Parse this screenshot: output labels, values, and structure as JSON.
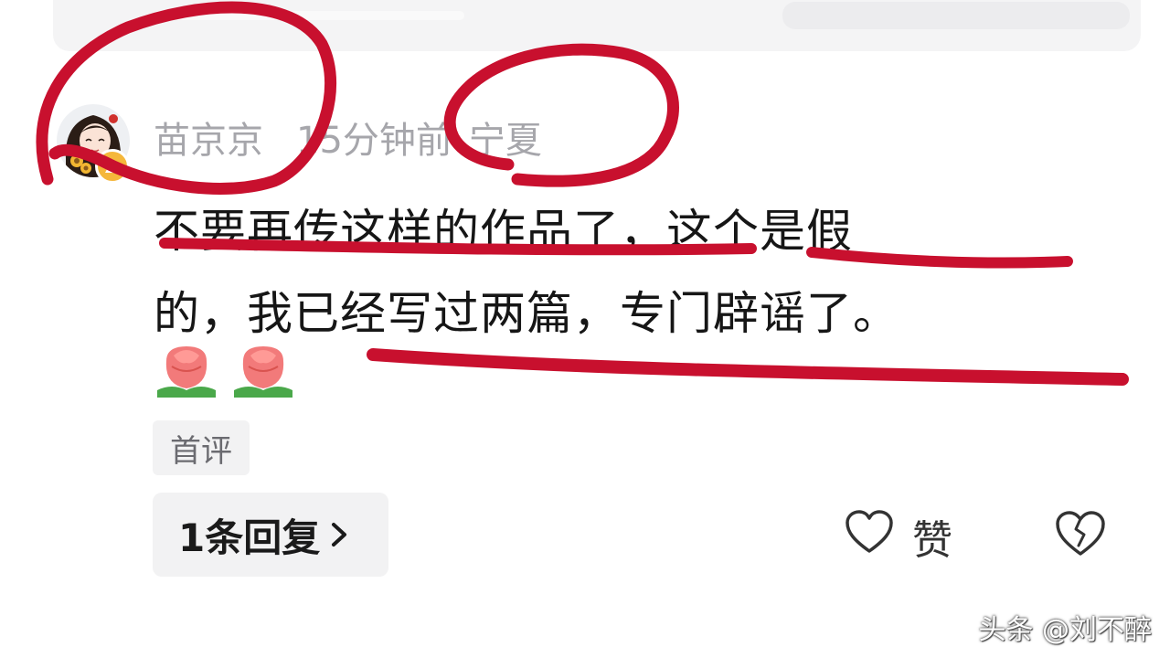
{
  "comment": {
    "author": "苗京京",
    "time": "15分钟前",
    "location": "宁夏",
    "lines": [
      "不要再传这样的作品了，这个是假",
      "的，我已经写过两篇，专门辟谣了。"
    ],
    "emoji": [
      "rose-emoji",
      "rose-emoji"
    ],
    "tag": "首评"
  },
  "actions": {
    "reply_label": "1条回复",
    "like_label": "赞"
  },
  "watermark": "头条 @刘不醉",
  "colors": {
    "annotation": "#c8102e",
    "meta_text": "#a6a6ab",
    "button_bg": "#f2f2f3",
    "badge": "#f5b73b"
  },
  "icons": [
    "avatar",
    "level-badge-icon",
    "chevron-right-icon",
    "heart-icon",
    "broken-heart-icon"
  ]
}
